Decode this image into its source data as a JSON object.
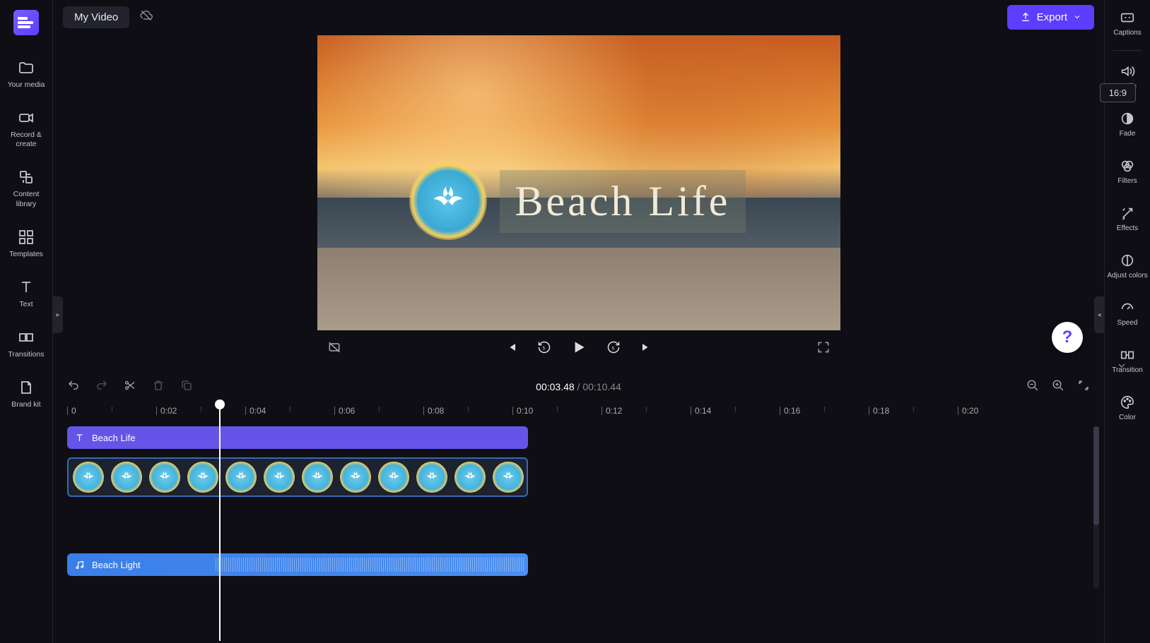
{
  "header": {
    "project_title": "My Video",
    "export_label": "Export"
  },
  "left_sidebar": {
    "items": [
      {
        "id": "your-media",
        "label": "Your media"
      },
      {
        "id": "record-create",
        "label": "Record & create"
      },
      {
        "id": "content-library",
        "label": "Content library"
      },
      {
        "id": "templates",
        "label": "Templates"
      },
      {
        "id": "text",
        "label": "Text"
      },
      {
        "id": "transitions",
        "label": "Transitions"
      },
      {
        "id": "brand-kit",
        "label": "Brand kit"
      }
    ]
  },
  "right_sidebar": {
    "items": [
      {
        "id": "captions",
        "label": "Captions"
      },
      {
        "id": "audio",
        "label": "Audio"
      },
      {
        "id": "fade",
        "label": "Fade"
      },
      {
        "id": "filters",
        "label": "Filters"
      },
      {
        "id": "effects",
        "label": "Effects"
      },
      {
        "id": "adjust-colors",
        "label": "Adjust colors"
      },
      {
        "id": "speed",
        "label": "Speed"
      },
      {
        "id": "transition",
        "label": "Transition"
      },
      {
        "id": "color",
        "label": "Color"
      }
    ]
  },
  "preview": {
    "overlay_title": "Beach Life",
    "aspect_ratio": "16:9"
  },
  "transport": {
    "current_time": "00:03.48",
    "total_time": "00:10.44"
  },
  "ruler": {
    "ticks": [
      "0",
      "0:02",
      "0:04",
      "0:06",
      "0:08",
      "0:10",
      "0:12",
      "0:14",
      "0:16",
      "0:18",
      "0:20"
    ]
  },
  "tracks": {
    "text_clip_label": "Beach Life",
    "audio_clip_label": "Beach Light"
  },
  "help_label": "?"
}
